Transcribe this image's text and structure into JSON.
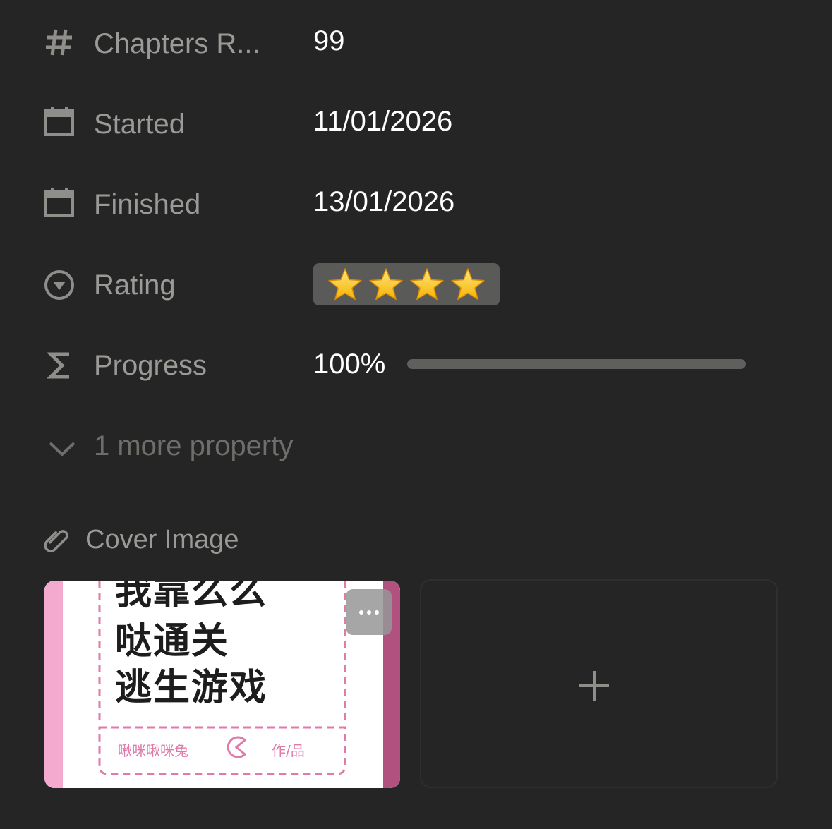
{
  "properties": [
    {
      "icon": "hash-icon",
      "label": "Chapters R...",
      "value": "99"
    },
    {
      "icon": "calendar-icon",
      "label": "Started",
      "value": "11/01/2026"
    },
    {
      "icon": "calendar-icon",
      "label": "Finished",
      "value": "13/01/2026"
    },
    {
      "icon": "select-icon",
      "label": "Rating",
      "value": "⭐⭐⭐⭐"
    },
    {
      "icon": "sigma-icon",
      "label": "Progress",
      "value": "100%"
    }
  ],
  "rating": {
    "stars": 4
  },
  "progress": {
    "fraction": 1.0
  },
  "more_properties": {
    "label": "1 more property",
    "icon": "chevron-down-icon"
  },
  "cover": {
    "label": "Cover Image",
    "icon": "paperclip-icon",
    "image_text": {
      "title_line1": "我靠么么",
      "title_line2": "哒通关",
      "title_line3": "逃生游戏",
      "author": "啾咪啾咪兔",
      "credit": "作/品"
    },
    "more_icon": "ellipsis-icon",
    "add_icon": "plus-icon"
  },
  "colors": {
    "background": "#252525",
    "label": "#9b9a97",
    "value": "#ffffff",
    "muted": "#6f6e6b",
    "cover_pink": "#f4a9cf",
    "cover_magenta": "#b0517f"
  }
}
